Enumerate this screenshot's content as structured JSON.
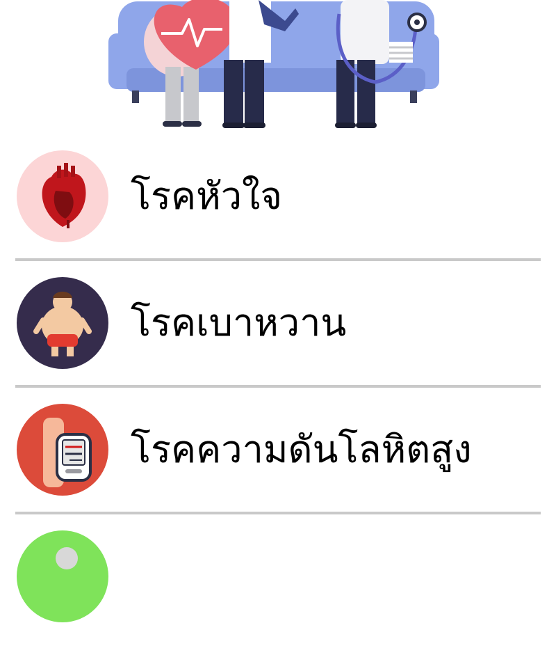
{
  "colors": {
    "divider": "#c9c9c9",
    "heart_bg": "#fcd5d6",
    "diabetes_bg": "#352c4c",
    "hypertension_bg": "#dc4b3a",
    "fourth_bg": "#7fe35a",
    "sofa": "#8fa6ea"
  },
  "hero": {
    "icon": "doctor-patients-sofa-illustration"
  },
  "items": [
    {
      "label": "โรคหัวใจ",
      "icon": "heart-organ-icon"
    },
    {
      "label": "โรคเบาหวาน",
      "icon": "overweight-person-icon"
    },
    {
      "label": "โรคความดันโลหิตสูง",
      "icon": "blood-pressure-monitor-icon"
    },
    {
      "label": "",
      "icon": "partial-round-icon"
    }
  ]
}
